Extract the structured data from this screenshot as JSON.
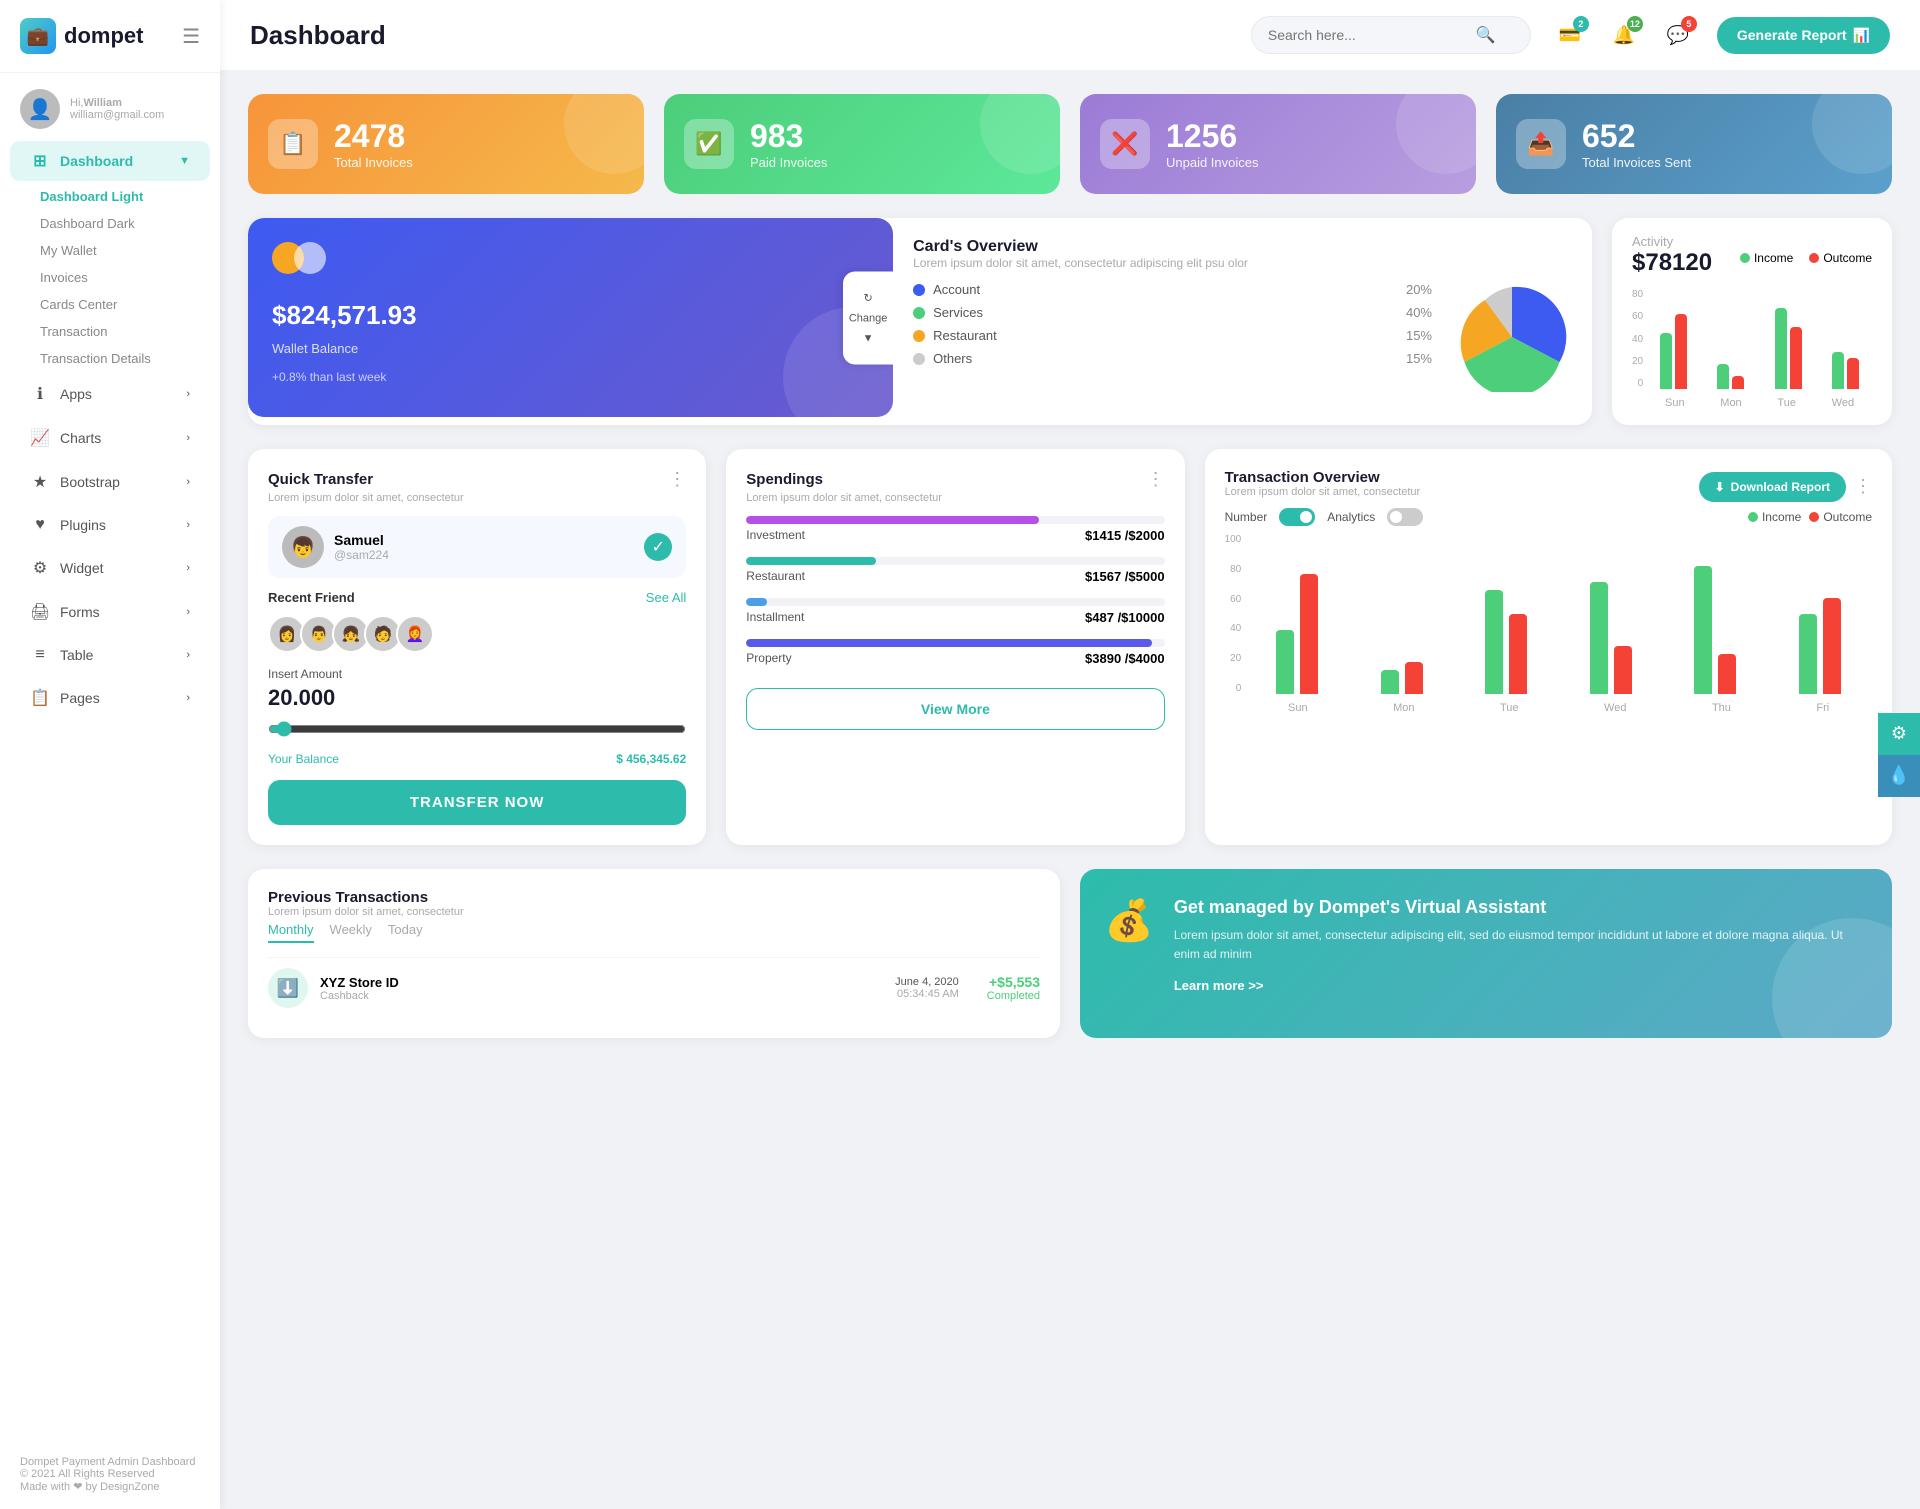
{
  "app": {
    "name": "dompet",
    "logo_emoji": "💼"
  },
  "header": {
    "title": "Dashboard",
    "search_placeholder": "Search here...",
    "generate_btn": "Generate Report",
    "badges": {
      "wallet": "2",
      "notifications": "12",
      "messages": "5"
    }
  },
  "user": {
    "greeting": "Hi,",
    "name": "William",
    "email": "william@gmail.com",
    "avatar_emoji": "👤"
  },
  "nav": {
    "dashboard": "Dashboard",
    "sub_items": [
      "Dashboard Light",
      "Dashboard Dark",
      "My Wallet",
      "Invoices",
      "Cards Center",
      "Transaction",
      "Transaction Details"
    ],
    "apps": "Apps",
    "charts": "Charts",
    "bootstrap": "Bootstrap",
    "plugins": "Plugins",
    "widget": "Widget",
    "forms": "Forms",
    "table": "Table",
    "pages": "Pages"
  },
  "stats": [
    {
      "label": "Total Invoices",
      "value": "2478",
      "icon": "📋",
      "color": "orange"
    },
    {
      "label": "Paid Invoices",
      "value": "983",
      "icon": "✅",
      "color": "green"
    },
    {
      "label": "Unpaid Invoices",
      "value": "1256",
      "icon": "❌",
      "color": "purple"
    },
    {
      "label": "Total Invoices Sent",
      "value": "652",
      "icon": "📤",
      "color": "teal"
    }
  ],
  "wallet": {
    "amount": "$824,571.93",
    "label": "Wallet Balance",
    "trend": "+0.8% than last week",
    "change_btn": "Change"
  },
  "cards_overview": {
    "title": "Card's Overview",
    "subtitle": "Lorem ipsum dolor sit amet, consectetur adipiscing elit psu olor",
    "legends": [
      {
        "label": "Account",
        "pct": "20%",
        "color": "#3d5af1"
      },
      {
        "label": "Services",
        "pct": "40%",
        "color": "#4cce7a"
      },
      {
        "label": "Restaurant",
        "pct": "15%",
        "color": "#f5a623"
      },
      {
        "label": "Others",
        "pct": "15%",
        "color": "#ccc"
      }
    ]
  },
  "activity": {
    "label": "Activity",
    "amount": "$78120",
    "income_label": "Income",
    "outcome_label": "Outcome",
    "chart_labels": [
      "Sun",
      "Mon",
      "Tue",
      "Wed"
    ],
    "income_bars": [
      45,
      20,
      65,
      30
    ],
    "outcome_bars": [
      60,
      10,
      50,
      25
    ]
  },
  "quick_transfer": {
    "title": "Quick Transfer",
    "subtitle": "Lorem ipsum dolor sit amet, consectetur",
    "person": {
      "name": "Samuel",
      "handle": "@sam224",
      "emoji": "👦"
    },
    "recent_label": "Recent Friend",
    "see_all": "See All",
    "friends": [
      "👩",
      "👨",
      "👧",
      "🧑",
      "👩‍🦰"
    ],
    "amount_label": "Insert Amount",
    "amount": "20.000",
    "balance_label": "Your Balance",
    "balance": "$ 456,345.62",
    "transfer_btn": "TRANSFER NOW"
  },
  "spendings": {
    "title": "Spendings",
    "subtitle": "Lorem ipsum dolor sit amet, consectetur",
    "items": [
      {
        "label": "Investment",
        "current": 1415,
        "max": 2000,
        "color": "#b44fe8",
        "display": "$1415 / $2000",
        "pct": 70
      },
      {
        "label": "Restaurant",
        "current": 1567,
        "max": 5000,
        "color": "#2dbcab",
        "display": "$1567 / $5000",
        "pct": 31
      },
      {
        "label": "Installment",
        "current": 487,
        "max": 10000,
        "color": "#4a9fe8",
        "display": "$487 / $10000",
        "pct": 5
      },
      {
        "label": "Property",
        "current": 3890,
        "max": 4000,
        "color": "#5a5ae8",
        "display": "$3890 / $4000",
        "pct": 97
      }
    ],
    "view_more": "View More"
  },
  "transaction_overview": {
    "title": "Transaction Overview",
    "subtitle": "Lorem ipsum dolor sit amet, consectetur",
    "number_label": "Number",
    "analytics_label": "Analytics",
    "income_label": "Income",
    "outcome_label": "Outcome",
    "download_btn": "Download Report",
    "chart_labels": [
      "Sun",
      "Mon",
      "Tue",
      "Wed",
      "Thu",
      "Fri"
    ],
    "income_bars": [
      40,
      15,
      65,
      70,
      80,
      50
    ],
    "outcome_bars": [
      75,
      20,
      50,
      30,
      25,
      60
    ]
  },
  "previous_transactions": {
    "title": "Previous Transactions",
    "subtitle": "Lorem ipsum dolor sit amet, consectetur",
    "tabs": [
      "Monthly",
      "Weekly",
      "Today"
    ],
    "items": [
      {
        "name": "XYZ Store ID",
        "type": "Cashback",
        "date": "June 4, 2020",
        "time": "05:34:45 AM",
        "amount": "+$5,553",
        "status": "Completed",
        "icon": "⬇️"
      }
    ]
  },
  "virtual_assistant": {
    "title": "Get managed by Dompet's Virtual Assistant",
    "text": "Lorem ipsum dolor sit amet, consectetur adipiscing elit, sed do eiusmod tempor incididunt ut labore et dolore magna aliqua. Ut enim ad minim",
    "link": "Learn more >>",
    "icon": "💰"
  },
  "sidebar_footer": {
    "brand": "Dompet Payment Admin Dashboard",
    "copyright": "© 2021 All Rights Reserved",
    "made_with": "Made with ❤ by DesignZone"
  }
}
